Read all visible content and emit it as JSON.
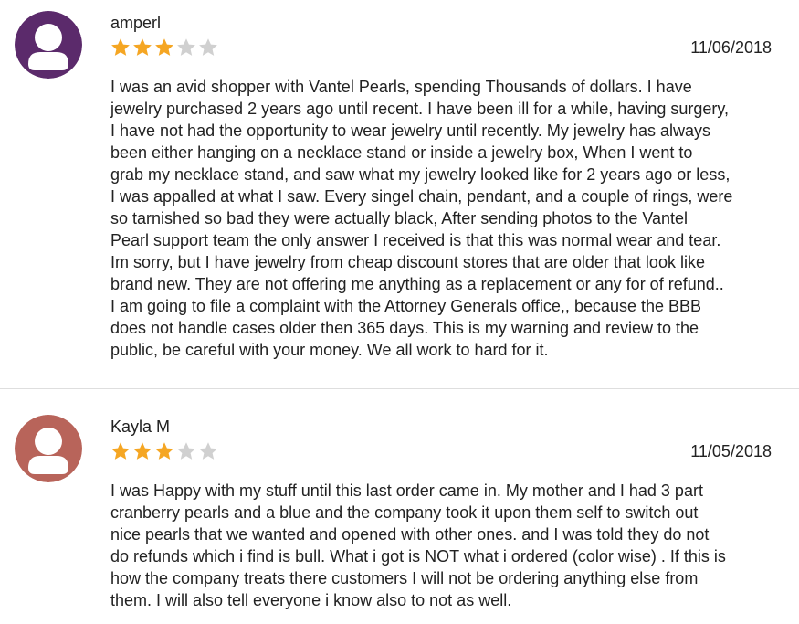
{
  "colors": {
    "avatar_1": "#5b2a6b",
    "avatar_2": "#b8645a",
    "star_filled": "#f5a623",
    "star_empty": "#d0d0d0",
    "divider": "#dedede"
  },
  "reviews": [
    {
      "name": "amperl",
      "date": "11/06/2018",
      "rating": 3,
      "max_rating": 5,
      "avatar_icon": "user-silhouette-icon",
      "lines": [
        "I was an avid shopper with Vantel Pearls, spending Thousands of dollars. I have",
        "jewelry purchased 2 years ago until recent. I have been ill for a while, having surgery,",
        "I have not had the opportunity to wear jewelry until recently. My jewelry has always",
        "been either hanging on a necklace stand or inside a jewelry box, When I went to",
        "grab my necklace stand, and saw what my jewelry looked like for 2 years ago or less,",
        "I was appalled at what I saw. Every singel chain, pendant, and a couple of rings, were",
        "so tarnished so bad they were actually black, After sending photos to the Vantel",
        "Pearl support team the only answer I received is that this was normal wear and tear.",
        "Im sorry, but I have jewelry from cheap discount stores that are older that look like",
        "brand new. They are not offering me anything as a replacement or any for of refund..",
        "I am going to file a complaint with the Attorney Generals office,, because the BBB",
        "does not handle cases older then 365 days. This is my warning and review to the",
        "public, be careful with your money. We all work to hard for it."
      ]
    },
    {
      "name": "Kayla M",
      "date": "11/05/2018",
      "rating": 3,
      "max_rating": 5,
      "avatar_icon": "user-silhouette-icon",
      "lines": [
        "I was Happy with my stuff until this last order came in. My mother and I had 3 part",
        "cranberry pearls and a blue and the company took it upon them self to switch out",
        "nice pearls that we wanted and opened with other ones. and I was told they do not",
        "do refunds which i find is bull. What i got is NOT what i ordered (color wise) . If this is",
        "how the company treats there customers I will not be ordering anything else from",
        "them. I will also tell everyone i know also to not as well."
      ]
    }
  ]
}
